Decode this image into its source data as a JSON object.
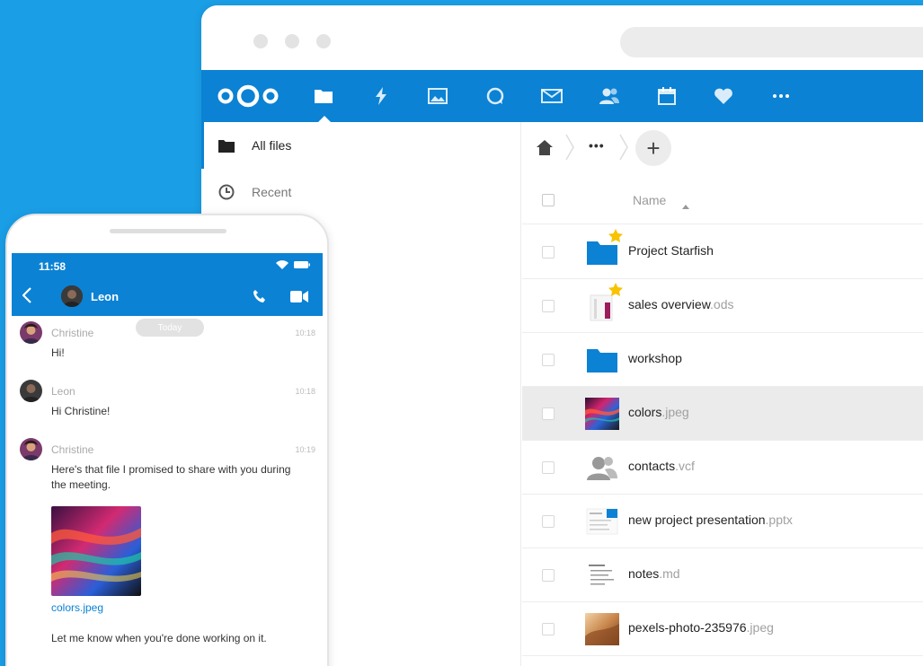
{
  "colors": {
    "brand": "#0b82d4",
    "background": "#1a9ee6",
    "star": "#f8c300"
  },
  "browser": {
    "nav_icons": [
      "nextcloud-logo",
      "files-icon",
      "activity-icon",
      "photos-icon",
      "talk-icon",
      "mail-icon",
      "contacts-icon",
      "calendar-icon",
      "favorites-icon",
      "more-icon"
    ],
    "sidebar": [
      {
        "label": "All files",
        "icon": "folder-icon",
        "active": true
      },
      {
        "label": "Recent",
        "icon": "clock-icon",
        "active": false
      }
    ],
    "breadcrumb": {
      "more": "•••",
      "add": "+"
    },
    "table_header": {
      "name": "Name"
    },
    "files": [
      {
        "name": "Project Starfish",
        "ext": "",
        "type": "folder",
        "favorite": true
      },
      {
        "name": "sales overview",
        "ext": ".ods",
        "type": "spreadsheet",
        "favorite": true
      },
      {
        "name": "workshop",
        "ext": "",
        "type": "folder",
        "favorite": false
      },
      {
        "name": "colors",
        "ext": ".jpeg",
        "type": "image-colors",
        "favorite": false,
        "selected": true
      },
      {
        "name": "contacts",
        "ext": ".vcf",
        "type": "contacts",
        "favorite": false
      },
      {
        "name": "new project presentation",
        "ext": ".pptx",
        "type": "presentation",
        "favorite": false
      },
      {
        "name": "notes",
        "ext": ".md",
        "type": "text",
        "favorite": false
      },
      {
        "name": "pexels-photo-235976",
        "ext": ".jpeg",
        "type": "image-photo",
        "favorite": false
      }
    ]
  },
  "phone": {
    "time": "11:58",
    "contact": "Leon",
    "today": "Today",
    "messages": [
      {
        "author": "Christine",
        "time": "10:18",
        "text": "Hi!"
      },
      {
        "author": "Leon",
        "time": "10:18",
        "text": "Hi Christine!"
      },
      {
        "author": "Christine",
        "time": "10:19",
        "text": "Here's that file I promised to share with you during the meeting."
      }
    ],
    "attachment": "colors.jpeg",
    "last_message": "Let me know when you're done working on it."
  }
}
